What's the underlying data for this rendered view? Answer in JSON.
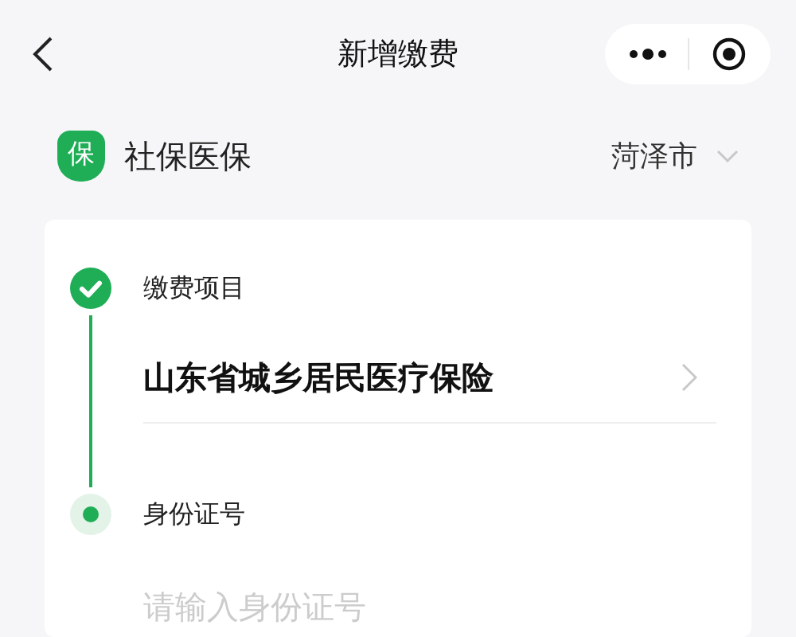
{
  "nav": {
    "title": "新增缴费"
  },
  "brand": {
    "badge": "保",
    "name": "社保医保",
    "city": "菏泽市"
  },
  "steps": [
    {
      "kind": "select",
      "done": true,
      "label": "缴费项目",
      "value": "山东省城乡居民医疗保险"
    },
    {
      "kind": "input",
      "done": false,
      "label": "身份证号",
      "placeholder": "请输入身份证号"
    }
  ]
}
